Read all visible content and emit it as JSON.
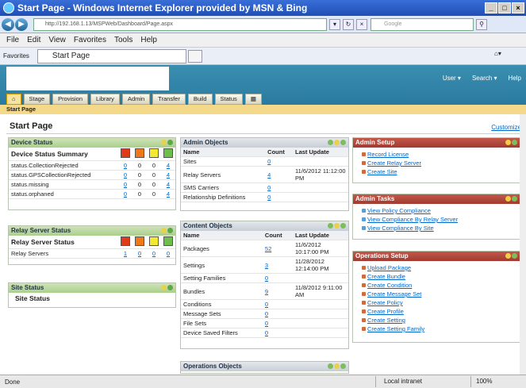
{
  "window": {
    "title": "Start Page - Windows Internet Explorer provided by MSN & Bing"
  },
  "address": {
    "url": "http://192.168.1.13/MSPWeb/Dashboard/Page.aspx",
    "search_placeholder": "Google"
  },
  "menu": [
    "File",
    "Edit",
    "View",
    "Favorites",
    "Tools",
    "Help"
  ],
  "favbar": {
    "favorites": "Favorites",
    "tab_title": "Start Page"
  },
  "topnav": {
    "user": "User ▾",
    "search": "Search ▾",
    "help": "Help"
  },
  "tabs": [
    "Stage",
    "Provision",
    "Library",
    "Admin",
    "Transfer",
    "Build",
    "Status"
  ],
  "breadcrumb": "Start Page",
  "page": {
    "title": "Start Page",
    "customize": "Customize"
  },
  "device_status": {
    "title": "Device Status",
    "summary_title": "Device Status Summary",
    "rows": [
      {
        "label": "status.CollectionRejected",
        "v": [
          "0",
          "0",
          "0",
          "4"
        ]
      },
      {
        "label": "status.GPSCollectionRejected",
        "v": [
          "0",
          "0",
          "0",
          "4"
        ]
      },
      {
        "label": "status.missing",
        "v": [
          "0",
          "0",
          "0",
          "4"
        ]
      },
      {
        "label": "status.orphaned",
        "v": [
          "0",
          "0",
          "0",
          "4"
        ]
      }
    ]
  },
  "relay_status": {
    "title": "Relay Server Status",
    "summary_title": "Relay Server Status",
    "row": {
      "label": "Relay Servers",
      "v": [
        "1",
        "0",
        "0",
        "0"
      ]
    }
  },
  "site_status": {
    "title": "Site Status",
    "summary_title": "Site Status"
  },
  "admin_objects": {
    "title": "Admin Objects",
    "headers": [
      "Name",
      "Count",
      "Last Update"
    ],
    "rows": [
      {
        "name": "Sites",
        "count": "0",
        "update": ""
      },
      {
        "name": "Relay Servers",
        "count": "4",
        "update": "11/6/2012 11:12:00 PM"
      },
      {
        "name": "SMS Carriers",
        "count": "0",
        "update": ""
      },
      {
        "name": "Relationship Definitions",
        "count": "0",
        "update": ""
      }
    ]
  },
  "content_objects": {
    "title": "Content Objects",
    "headers": [
      "Name",
      "Count",
      "Last Update"
    ],
    "rows": [
      {
        "name": "Packages",
        "count": "52",
        "update": "11/6/2012 10:17:00 PM"
      },
      {
        "name": "Settings",
        "count": "3",
        "update": "11/28/2012 12:14:00 PM"
      },
      {
        "name": "Setting Families",
        "count": "0",
        "update": ""
      },
      {
        "name": "Bundles",
        "count": "9",
        "update": "11/8/2012 9:11:00 AM"
      },
      {
        "name": "Conditions",
        "count": "0",
        "update": ""
      },
      {
        "name": "Message Sets",
        "count": "0",
        "update": ""
      },
      {
        "name": "File Sets",
        "count": "0",
        "update": ""
      },
      {
        "name": "Device Saved Filters",
        "count": "0",
        "update": ""
      }
    ]
  },
  "operations_objects": {
    "title": "Operations Objects"
  },
  "admin_setup": {
    "title": "Admin Setup",
    "links": [
      "Record License",
      "Create Relay Server",
      "Create Site"
    ]
  },
  "admin_tasks": {
    "title": "Admin Tasks",
    "links": [
      "View Policy Compliance",
      "View Compliance By Relay Server",
      "View Compliance By Site"
    ]
  },
  "operations_setup": {
    "title": "Operations Setup",
    "links": [
      "Upload Package",
      "Create Bundle",
      "Create Condition",
      "Create Message Set",
      "Create Policy",
      "Create Profile",
      "Create Setting",
      "Create Setting Family"
    ]
  },
  "statusbar": {
    "left": "Done",
    "zone": "Local intranet",
    "zoom": "100%"
  }
}
